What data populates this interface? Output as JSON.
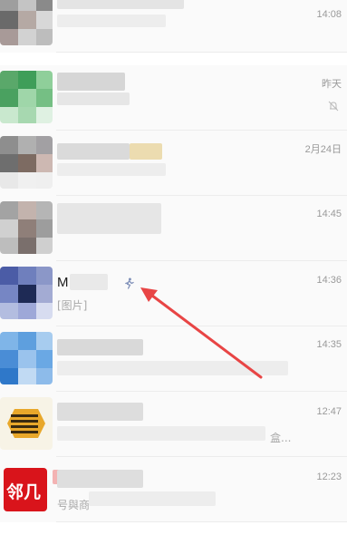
{
  "conversations": [
    {
      "time": "14:08"
    },
    {
      "time": "昨天",
      "muted_icon": "bell-off-icon"
    },
    {
      "time": "2月24日"
    },
    {
      "time": "14:45"
    },
    {
      "name": "M    N",
      "preview": "[图片]",
      "time": "14:36",
      "badge_icon": "runner-icon"
    },
    {
      "time": "14:35"
    },
    {
      "time": "12:47",
      "preview_suffix": "盒..."
    },
    {
      "time": "12:23",
      "avatar_text": "邻几",
      "preview_fragment": "号與商"
    }
  ],
  "annotation": {
    "color": "#e84545",
    "icon": "red-arrow"
  }
}
